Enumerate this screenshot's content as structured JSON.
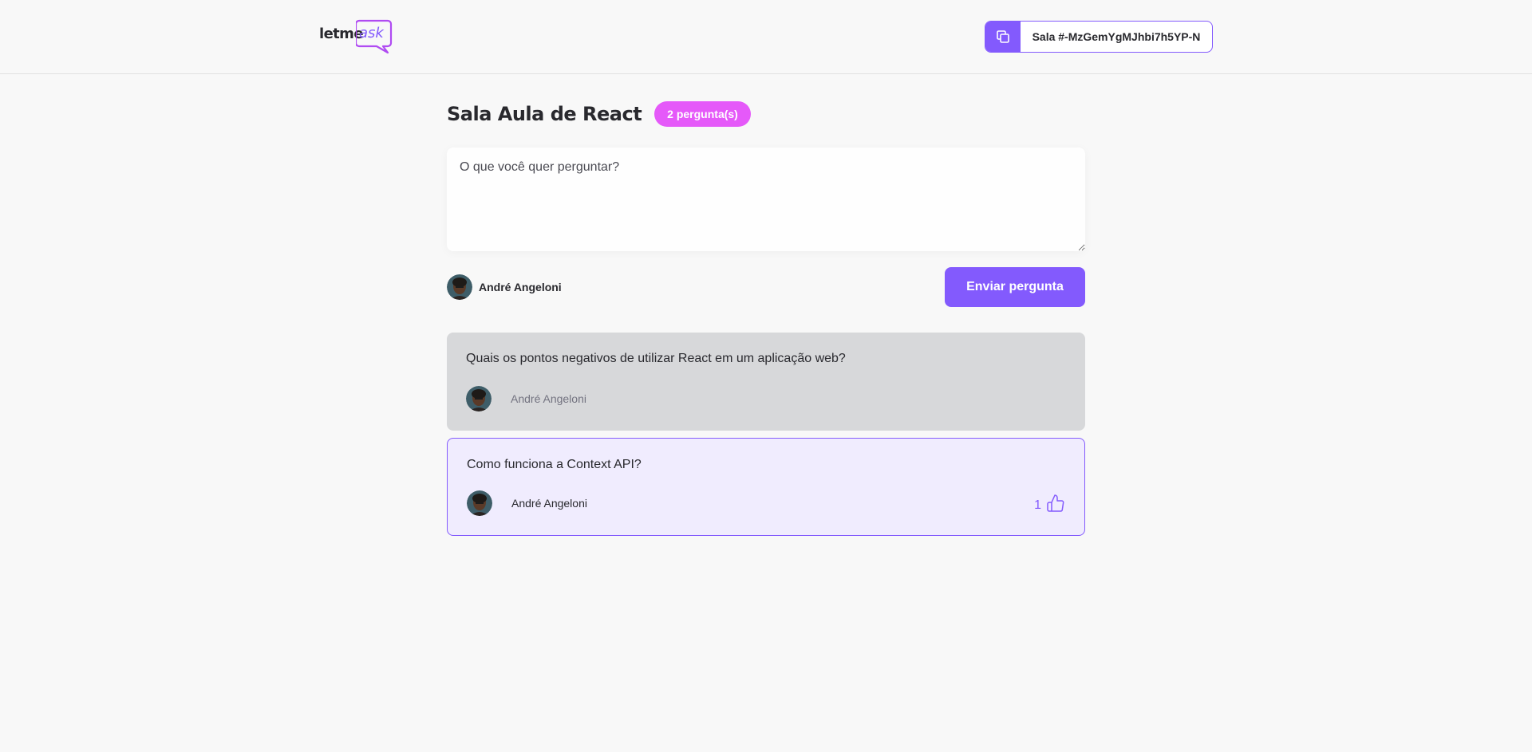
{
  "header": {
    "logo": {
      "part1": "letme",
      "part2": "ask"
    },
    "room_code": {
      "label": "Sala #-MzGemYgMJhbi7h5YP-N",
      "icon": "copy-icon"
    }
  },
  "room": {
    "title": "Sala Aula de React",
    "question_count_badge": "2 pergunta(s)"
  },
  "form": {
    "placeholder": "O que você quer perguntar?",
    "user_name": "André Angeloni",
    "submit_label": "Enviar pergunta"
  },
  "questions": [
    {
      "text": "Quais os pontos negativos de utilizar React em um aplicação web?",
      "author": "André Angeloni",
      "state": "highlighted"
    },
    {
      "text": "Como funciona a Context API?",
      "author": "André Angeloni",
      "state": "liked",
      "like_count": "1",
      "like_icon": "thumbs-up-icon"
    }
  ],
  "colors": {
    "brand_purple": "#835afd",
    "badge_pink": "#e559f9",
    "background": "#f8f8f8",
    "highlighted_question_bg": "#d7d8da",
    "liked_question_bg": "#f0ecfe"
  }
}
